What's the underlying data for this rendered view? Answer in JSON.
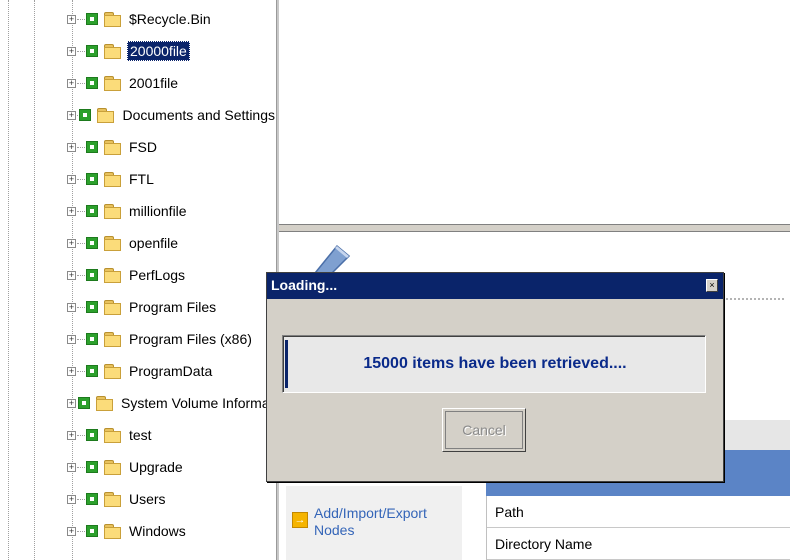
{
  "tree": {
    "items": [
      {
        "label": "$Recycle.Bin",
        "expander": "+",
        "selected": false
      },
      {
        "label": "20000file",
        "expander": "+",
        "selected": true
      },
      {
        "label": "2001file",
        "expander": "+",
        "selected": false
      },
      {
        "label": "Documents and Settings",
        "expander": "+",
        "selected": false
      },
      {
        "label": "FSD",
        "expander": "+",
        "selected": false
      },
      {
        "label": "FTL",
        "expander": "+",
        "selected": false
      },
      {
        "label": "millionfile",
        "expander": "+",
        "selected": false
      },
      {
        "label": "openfile",
        "expander": "+",
        "selected": false
      },
      {
        "label": "PerfLogs",
        "expander": "+",
        "selected": false
      },
      {
        "label": "Program Files",
        "expander": "+",
        "selected": false
      },
      {
        "label": "Program Files (x86)",
        "expander": "+",
        "selected": false
      },
      {
        "label": "ProgramData",
        "expander": "+",
        "selected": false
      },
      {
        "label": "System Volume Informatic",
        "expander": "+",
        "selected": false
      },
      {
        "label": "test",
        "expander": "+",
        "selected": false
      },
      {
        "label": "Upgrade",
        "expander": "+",
        "selected": false
      },
      {
        "label": "Users",
        "expander": "+",
        "selected": false
      },
      {
        "label": "Windows",
        "expander": "+",
        "selected": false
      }
    ]
  },
  "dialog": {
    "title": "Loading...",
    "close_glyph": "×",
    "message": "15000 items have been retrieved....",
    "cancel_label": "Cancel"
  },
  "sidebar": {
    "link_label": "Add/Import/Export Nodes",
    "link_icon_glyph": "→"
  },
  "grid": {
    "rows": [
      "Path",
      "Directory Name"
    ]
  },
  "colors": {
    "titlebar": "#0a246a",
    "selection": "#0a246a",
    "checkbox": "#2ca02c",
    "folder": "#fbdc7a",
    "link": "#3465b8",
    "header": "#5b84c6"
  },
  "icons": {
    "tree_checkbox": "green-check-icon",
    "tree_folder": "folder-icon",
    "dialog_close": "close-icon",
    "link": "arrow-right-icon"
  }
}
